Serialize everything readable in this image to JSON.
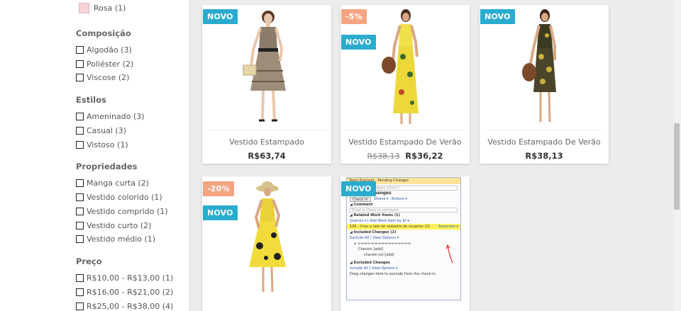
{
  "filters": {
    "color_item": {
      "label": "Rosa (1)",
      "swatch_color": "#f8d4d8"
    },
    "sections": [
      {
        "title": "Composição",
        "items": [
          "Algodão (3)",
          "Poliéster (2)",
          "Viscose (2)"
        ]
      },
      {
        "title": "Estilos",
        "items": [
          "Ameninado (3)",
          "Casual (3)",
          "Vistoso (1)"
        ]
      },
      {
        "title": "Propriedades",
        "items": [
          "Manga curta (2)",
          "Vestido colorido (1)",
          "Vestido comprido (1)",
          "Vestido curto (2)",
          "Vestido médio (1)"
        ]
      },
      {
        "title": "Preço",
        "items": [
          "R$10,00 - R$13,00 (1)",
          "R$16,00 - R$21,00 (2)",
          "R$25,00 - R$38,00 (4)"
        ]
      }
    ]
  },
  "products": [
    {
      "name": "Vestido Estampado",
      "old_price": "",
      "price": "R$63,74",
      "badges": [
        "NOVO"
      ]
    },
    {
      "name": "Vestido Estampado De Verão",
      "old_price": "R$38,13",
      "price": "R$36,22",
      "badges": [
        "-5%",
        "NOVO"
      ]
    },
    {
      "name": "Vestido Estampado De Verão",
      "old_price": "",
      "price": "R$38,13",
      "badges": [
        "NOVO"
      ]
    },
    {
      "name": "",
      "old_price": "",
      "price": "",
      "badges": [
        "-20%",
        "NOVO"
      ]
    },
    {
      "name": "",
      "old_price": "",
      "price": "",
      "badges": [
        "NOVO"
      ]
    }
  ],
  "embedded_screenshot": {
    "title": "Team Explorer - Pending Changes",
    "search_placeholder": "Search Work Items (Ctrl+')",
    "heading": "Pending Changes",
    "check_in": "Check In",
    "shelve": "Shelve ▾",
    "actions": "Actions ▾",
    "comment_header": "◢ Comment",
    "comment_placeholder": "Enter a check-in comment",
    "related_header": "◢ Related Work Items (1)",
    "related_links": "Queries ▾ | Add Work Item by ID ▾",
    "work_item": "106 - Criar a tela de cadastro de usuarios (U)",
    "associate": "Associate ▾",
    "included_header": "◢ Included Changes (2)",
    "included_links": "Exclude All | View Options ▾",
    "folder_item": "Checkin [add]",
    "file_item": "checkin.txt [add]",
    "excluded_header": "◢ Excluded Changes",
    "excluded_links": "Include All | View Options ▾",
    "excluded_note": "Drag changes here to exclude from the check-in."
  },
  "colors": {
    "badge_new": "#2aaccf",
    "badge_discount": "#f3a582",
    "highlight": "#fff35a"
  }
}
